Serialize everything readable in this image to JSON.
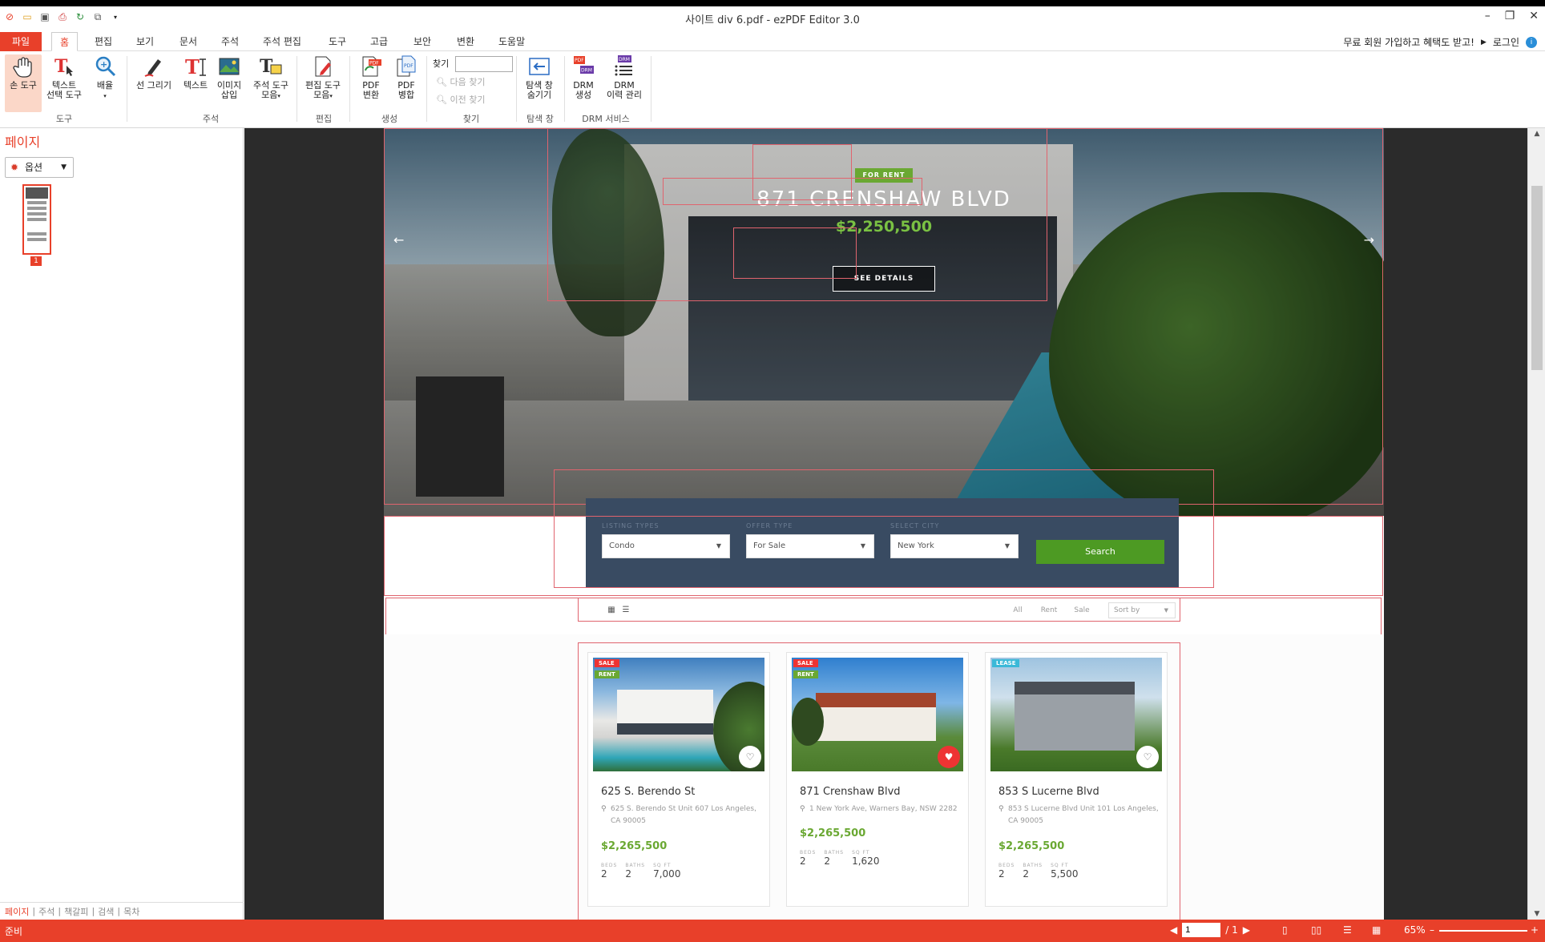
{
  "window": {
    "title": "사이트 div 6.pdf - ezPDF Editor 3.0"
  },
  "tabs": {
    "file": "파일",
    "home": "홈",
    "edit": "편집",
    "view": "보기",
    "document": "문서",
    "annotation": "주석",
    "annotation_edit": "주석 편집",
    "tools": "도구",
    "advanced": "고급",
    "security": "보안",
    "convert": "변환",
    "help": "도움말"
  },
  "promo": {
    "signup": "무료 회원 가입하고 혜택도 받고!",
    "login": "로그인"
  },
  "ribbon": {
    "hand_tool": "손 도구",
    "text_select_1": "텍스트",
    "text_select_2": "선택 도구",
    "zoom": "배율",
    "group_tools": "도구",
    "line_draw": "선 그리기",
    "text": "텍스트",
    "image_insert_1": "이미지",
    "image_insert_2": "삽입",
    "annot_tools_1": "주석 도구",
    "annot_tools_2": "모음",
    "group_annotation": "주석",
    "edit_tools_1": "편집 도구",
    "edit_tools_2": "모음",
    "group_edit": "편집",
    "pdf_convert_1": "PDF",
    "pdf_convert_2": "변환",
    "pdf_merge_1": "PDF",
    "pdf_merge_2": "병합",
    "group_create": "생성",
    "find_label": "찾기",
    "find_next": "다음 찾기",
    "find_prev": "이전 찾기",
    "group_find": "찾기",
    "nav_toggle_1": "탐색 창",
    "nav_toggle_2": "숨기기",
    "group_nav": "탐색 창",
    "drm_create_1": "DRM",
    "drm_create_2": "생성",
    "drm_history_1": "DRM",
    "drm_history_2": "이력 관리",
    "group_drm": "DRM 서비스"
  },
  "leftpanel": {
    "title": "페이지",
    "options": "옵션",
    "thumb_page": "1",
    "bottom_tabs": [
      "페이지",
      "주석",
      "책갈피",
      "검색",
      "목차"
    ]
  },
  "hero": {
    "badge": "FOR RENT",
    "title": "871 CRENSHAW BLVD",
    "price": "$2,250,500",
    "button": "SEE DETAILS"
  },
  "search": {
    "listing_types_label": "LISTING TYPES",
    "listing_types_value": "Condo",
    "offer_type_label": "OFFER TYPE",
    "offer_type_value": "For Sale",
    "select_city_label": "SELECT CITY",
    "select_city_value": "New York",
    "button": "Search"
  },
  "filters": {
    "all": "All",
    "rent": "Rent",
    "sale": "Sale",
    "sort": "Sort by"
  },
  "cards": [
    {
      "tags": [
        "SALE",
        "RENT"
      ],
      "name": "625 S. Berendo St",
      "address": "625 S. Berendo St Unit 607 Los Angeles, CA 90005",
      "price": "$2,265,500",
      "beds_label": "BEDS",
      "beds": "2",
      "baths_label": "BATHS",
      "baths": "2",
      "sqft_label": "SQ FT",
      "sqft": "7,000"
    },
    {
      "tags": [
        "SALE",
        "RENT"
      ],
      "name": "871 Crenshaw Blvd",
      "address": "1 New York Ave, Warners Bay, NSW 2282",
      "price": "$2,265,500",
      "beds_label": "BEDS",
      "beds": "2",
      "baths_label": "BATHS",
      "baths": "2",
      "sqft_label": "SQ FT",
      "sqft": "1,620"
    },
    {
      "tags": [
        "LEASE"
      ],
      "name": "853 S Lucerne Blvd",
      "address": "853 S Lucerne Blvd Unit 101 Los Angeles, CA 90005",
      "price": "$2,265,500",
      "beds_label": "BEDS",
      "beds": "2",
      "baths_label": "BATHS",
      "baths": "2",
      "sqft_label": "SQ FT",
      "sqft": "5,500"
    }
  ],
  "statusbar": {
    "ready": "준비",
    "page_input": "1",
    "page_total": "/ 1",
    "zoom": "65%"
  },
  "colors": {
    "accent": "#e8402a",
    "search_bg": "#394b62",
    "search_btn": "#4d9a23",
    "price_green": "#6aa832"
  }
}
